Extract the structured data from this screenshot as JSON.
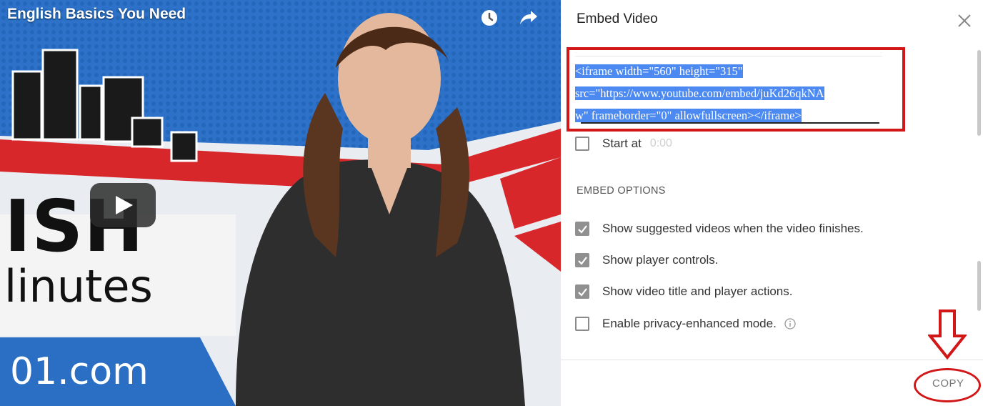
{
  "video": {
    "title": "English Basics You Need",
    "big_line1": "ISH",
    "big_line2": "linutes",
    "domain": "01.com",
    "icons": [
      "watch-later-icon",
      "share-icon",
      "play-icon"
    ]
  },
  "dialog": {
    "title": "Embed Video",
    "embed_code": [
      "<iframe width=\"560\" height=\"315\"",
      "src=\"https://www.youtube.com/embed/juKd26qkNA",
      "w\" frameborder=\"0\" allowfullscreen></iframe>"
    ],
    "start_at": {
      "label": "Start at",
      "time": "0:00",
      "checked": false
    },
    "section_heading": "EMBED OPTIONS",
    "options": [
      {
        "label": "Show suggested videos when the video finishes.",
        "checked": true
      },
      {
        "label": "Show player controls.",
        "checked": true
      },
      {
        "label": "Show video title and player actions.",
        "checked": true
      },
      {
        "label": "Enable privacy-enhanced mode.",
        "checked": false
      }
    ],
    "copy_label": "COPY"
  },
  "colors": {
    "highlight": "#4c89f1",
    "annotation_red": "#d11717",
    "checkbox_checked": "#909090"
  }
}
